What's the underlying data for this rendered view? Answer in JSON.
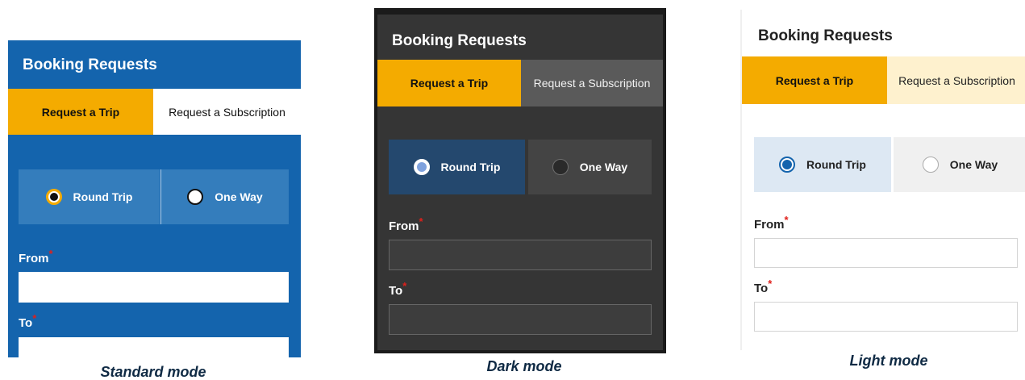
{
  "colors": {
    "standard_bg": "#1464ad",
    "accent": "#f4ab00",
    "dark_bg": "#353535",
    "light_selected": "#dde8f3",
    "required": "#e0201b",
    "caption": "#0f2a44"
  },
  "panels": {
    "standard": {
      "title": "Booking Requests",
      "tabs": [
        "Request a Trip",
        "Request a Subscription"
      ],
      "options": [
        "Round Trip",
        "One Way"
      ],
      "from_label": "From",
      "to_label": "To",
      "required_mark": "*",
      "caption": "Standard mode"
    },
    "dark": {
      "title": "Booking Requests",
      "tabs": [
        "Request a Trip",
        "Request a Subscription"
      ],
      "options": [
        "Round Trip",
        "One Way"
      ],
      "from_label": "From",
      "to_label": "To",
      "required_mark": "*",
      "caption": "Dark mode"
    },
    "light": {
      "title": "Booking Requests",
      "tabs": [
        "Request a Trip",
        "Request a Subscription"
      ],
      "options": [
        "Round Trip",
        "One Way"
      ],
      "from_label": "From",
      "to_label": "To",
      "required_mark": "*",
      "caption": "Light mode"
    }
  }
}
